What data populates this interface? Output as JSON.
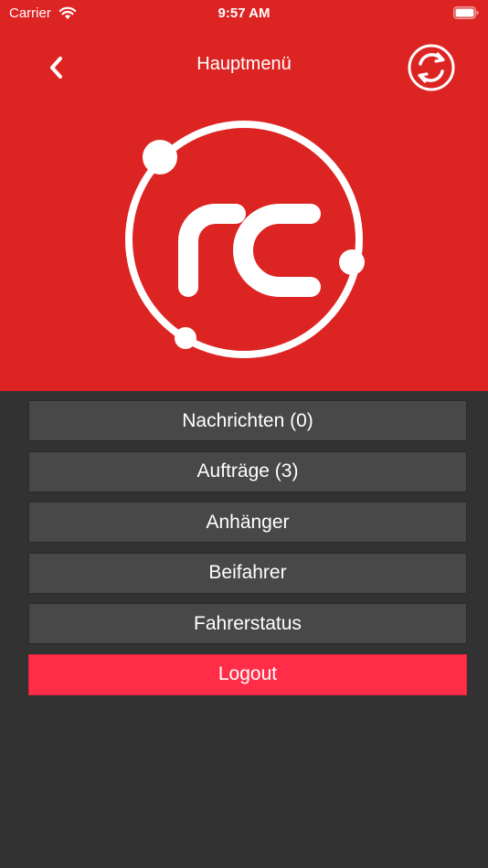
{
  "status_bar": {
    "carrier": "Carrier",
    "time": "9:57 AM"
  },
  "nav": {
    "title": "Hauptmenü",
    "back_icon": "chevron-left-icon",
    "sync_icon": "refresh-icon"
  },
  "logo": {
    "text": "rc"
  },
  "menu": {
    "items": [
      {
        "label": "Nachrichten (0)"
      },
      {
        "label": "Aufträge (3)"
      },
      {
        "label": "Anhänger"
      },
      {
        "label": "Beifahrer"
      },
      {
        "label": "Fahrerstatus"
      }
    ],
    "logout_label": "Logout"
  },
  "colors": {
    "header_red": "#dc2423",
    "background": "#323232",
    "button": "#484848",
    "logout": "#ff2d48"
  }
}
